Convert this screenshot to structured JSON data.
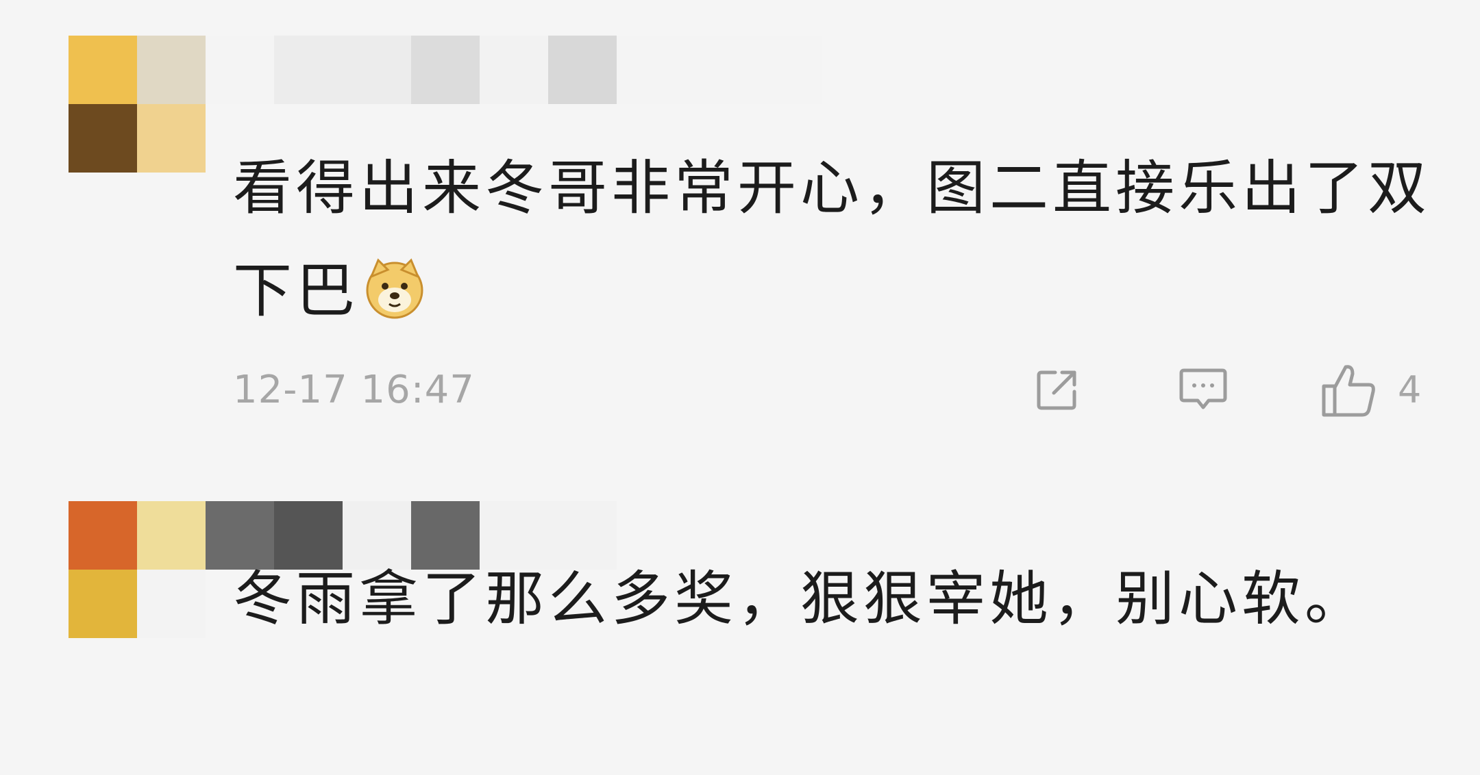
{
  "comments": [
    {
      "avatar_colors": [
        "#efc04f",
        "#e0d8c4",
        "#6d4a1f",
        "#f0d28f"
      ],
      "username_colors": [
        "#f4f4f4",
        "#ececec",
        "#dcdcdc",
        "#f2f2f2",
        "#d8d8d8",
        "#f4f4f4"
      ],
      "text": "看得出来冬哥非常开心，图二直接乐出了双下巴",
      "emoji": "doge-emoji",
      "timestamp": "12-17 16:47",
      "like_count": "4"
    },
    {
      "avatar_colors": [
        "#d7662a",
        "#efdd9a",
        "#e2b53b",
        "#f3f3f3"
      ],
      "username_colors": [
        "#6b6b6b",
        "#555555",
        "#f0f0f0",
        "#686868",
        "#f2f2f2"
      ],
      "text": "冬雨拿了那么多奖，狠狠宰她，别心软。"
    }
  ],
  "icons": {
    "share": "share-icon",
    "reply": "comment-icon",
    "like": "thumbs-up-icon"
  },
  "colors": {
    "background": "#f5f5f5",
    "text": "#1c1c1c",
    "meta": "#a6a6a6"
  }
}
